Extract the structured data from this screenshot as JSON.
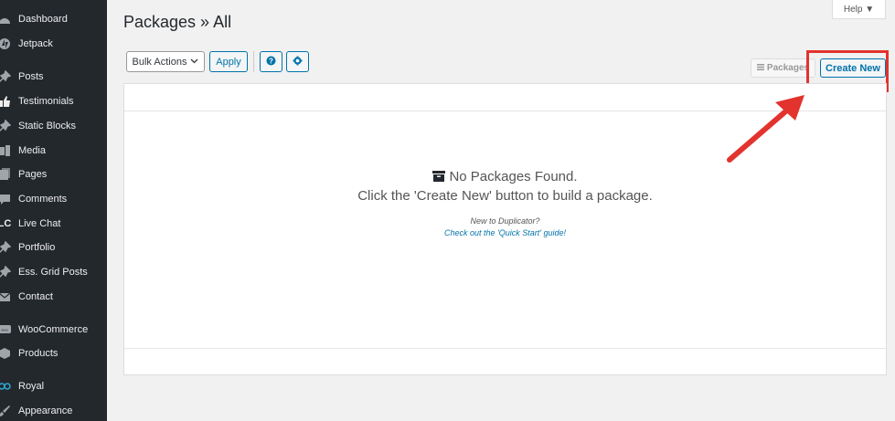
{
  "sidebar": {
    "items": [
      {
        "label": "Dashboard",
        "icon": "dashboard-icon"
      },
      {
        "label": "Jetpack",
        "icon": "jetpack-icon"
      },
      {
        "label": "Posts",
        "icon": "pin-icon"
      },
      {
        "label": "Testimonials",
        "icon": "thumbs-up-icon"
      },
      {
        "label": "Static Blocks",
        "icon": "pin-icon"
      },
      {
        "label": "Media",
        "icon": "media-icon"
      },
      {
        "label": "Pages",
        "icon": "pages-icon"
      },
      {
        "label": "Comments",
        "icon": "comments-icon"
      },
      {
        "label": "Live Chat",
        "icon": "live-chat-icon"
      },
      {
        "label": "Portfolio",
        "icon": "pin-icon"
      },
      {
        "label": "Ess. Grid Posts",
        "icon": "pin-icon"
      },
      {
        "label": "Contact",
        "icon": "mail-icon"
      },
      {
        "label": "WooCommerce",
        "icon": "woocommerce-icon"
      },
      {
        "label": "Products",
        "icon": "products-icon"
      },
      {
        "label": "Royal",
        "icon": "royal-icon"
      },
      {
        "label": "Appearance",
        "icon": "brush-icon"
      }
    ]
  },
  "header": {
    "title": "Packages » All",
    "help_label": "Help ▼"
  },
  "toolbar": {
    "bulk_actions_label": "Bulk Actions",
    "apply_label": "Apply",
    "packages_label": "Packages",
    "create_new_label": "Create New"
  },
  "empty_state": {
    "title": "No Packages Found.",
    "description": "Click the 'Create New' button to build a package.",
    "new_to": "New to Duplicator?",
    "quick_start_link": "Check out the 'Quick Start' guide!"
  },
  "colors": {
    "sidebar_bg": "#23282d",
    "accent": "#0073aa",
    "highlight": "#e2332e"
  }
}
